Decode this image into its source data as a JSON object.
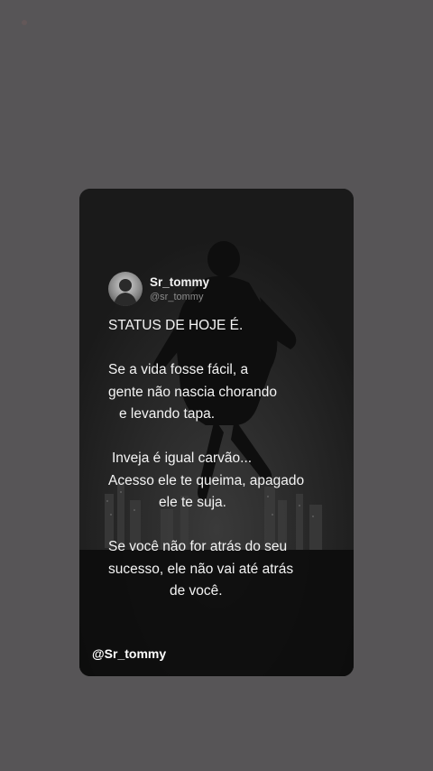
{
  "profile": {
    "display_name": "Sr_tommy",
    "handle": "@sr_tommy"
  },
  "quote": {
    "title": "STATUS DE HOJE É.",
    "paragraph1": [
      "Se a vida fosse fácil, a",
      "gente não nascia chorando",
      "e levando tapa."
    ],
    "paragraph2": [
      "Inveja é igual carvão...",
      "Acesso ele te queima, apagado",
      "ele te suja."
    ],
    "paragraph3": [
      "Se você não for atrás do seu",
      "sucesso, ele não vai até atrás",
      "de você."
    ]
  },
  "watermark": "@Sr_tommy",
  "colors": {
    "page_background": "#575557",
    "card_background": "#1c1c1c",
    "text": "#f4f4f4",
    "handle_text": "#8a8a8a"
  },
  "icons": {
    "avatar": "person-silhouette-avatar"
  }
}
